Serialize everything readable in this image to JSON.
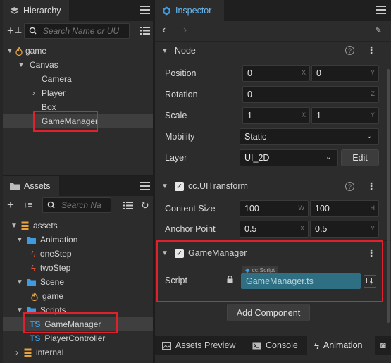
{
  "hierarchy": {
    "tab_label": "Hierarchy",
    "search_placeholder": "Search Name or UU",
    "tree": [
      {
        "label": "game",
        "icon": "scene-icon"
      },
      {
        "label": "Canvas"
      },
      {
        "label": "Camera"
      },
      {
        "label": "Player"
      },
      {
        "label": "Box"
      },
      {
        "label": "GameManager",
        "selected": true
      }
    ]
  },
  "assets": {
    "tab_label": "Assets",
    "search_placeholder": "Search Na",
    "tree": [
      {
        "label": "assets"
      },
      {
        "label": "Animation"
      },
      {
        "label": "oneStep"
      },
      {
        "label": "twoStep"
      },
      {
        "label": "Scene"
      },
      {
        "label": "game"
      },
      {
        "label": "Scripts"
      },
      {
        "label": "GameManager",
        "badge": "TS",
        "selected": true
      },
      {
        "label": "PlayerController",
        "badge": "TS"
      },
      {
        "label": "internal"
      }
    ]
  },
  "inspector": {
    "tab_label": "Inspector",
    "node_section": "Node",
    "position": {
      "label": "Position",
      "x": "0",
      "y": "0",
      "x_axis": "X",
      "y_axis": "Y"
    },
    "rotation": {
      "label": "Rotation",
      "z": "0",
      "z_axis": "Z"
    },
    "scale": {
      "label": "Scale",
      "x": "1",
      "y": "1",
      "x_axis": "X",
      "y_axis": "Y"
    },
    "mobility": {
      "label": "Mobility",
      "value": "Static"
    },
    "layer": {
      "label": "Layer",
      "value": "UI_2D",
      "edit_label": "Edit"
    },
    "uitransform": {
      "title": "cc.UITransform",
      "content_size": {
        "label": "Content Size",
        "w": "100",
        "h": "100",
        "w_axis": "W",
        "h_axis": "H"
      },
      "anchor_point": {
        "label": "Anchor Point",
        "x": "0.5",
        "y": "0.5",
        "x_axis": "X",
        "y_axis": "Y"
      }
    },
    "gamemanager": {
      "title": "GameManager",
      "script_label": "Script",
      "script_tag": "cc.Script",
      "script_value": "GameManager.ts"
    },
    "add_component_label": "Add Component"
  },
  "bottom_tabs": {
    "assets_preview": "Assets Preview",
    "console": "Console",
    "animation": "Animation"
  },
  "colors": {
    "accent": "#3e9be0",
    "highlight": "#e0202a",
    "script_field": "#2f6f83"
  }
}
